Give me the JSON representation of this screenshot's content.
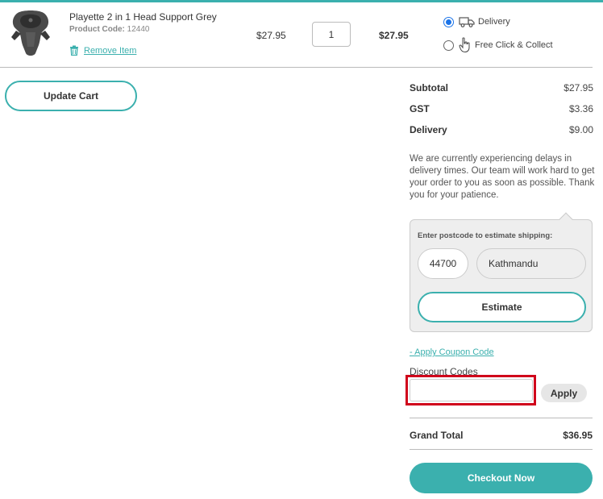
{
  "colors": {
    "accent": "#3bb0ae",
    "highlight": "#d0021b",
    "radio": "#1a73e8"
  },
  "item": {
    "image_icon": "head-support-product-image",
    "name": "Playette 2 in 1 Head Support Grey",
    "code_label": "Product Code:",
    "code_value": "12440",
    "remove_label": "Remove Item",
    "unit_price": "$27.95",
    "quantity": "1",
    "line_total": "$27.95"
  },
  "shipping_options": {
    "delivery_label": "Delivery",
    "delivery_selected": true,
    "collect_label": "Free Click & Collect",
    "collect_selected": false
  },
  "cart": {
    "update_label": "Update Cart"
  },
  "summary": {
    "subtotal_label": "Subtotal",
    "subtotal_value": "$27.95",
    "gst_label": "GST",
    "gst_value": "$3.36",
    "delivery_label": "Delivery",
    "delivery_value": "$9.00",
    "notice": "We are currently experiencing delays in delivery times. Our team will work hard to get your order to you as soon as possible. Thank you for your patience."
  },
  "estimate": {
    "label": "Enter postcode to estimate shipping:",
    "postcode": "44700",
    "city": "Kathmandu",
    "button_label": "Estimate"
  },
  "coupon": {
    "link_label": "- Apply Coupon Code",
    "discount_label": "Discount Codes",
    "input_value": "",
    "apply_label": "Apply"
  },
  "grand_total": {
    "label": "Grand Total",
    "value": "$36.95"
  },
  "checkout": {
    "label": "Checkout Now"
  }
}
